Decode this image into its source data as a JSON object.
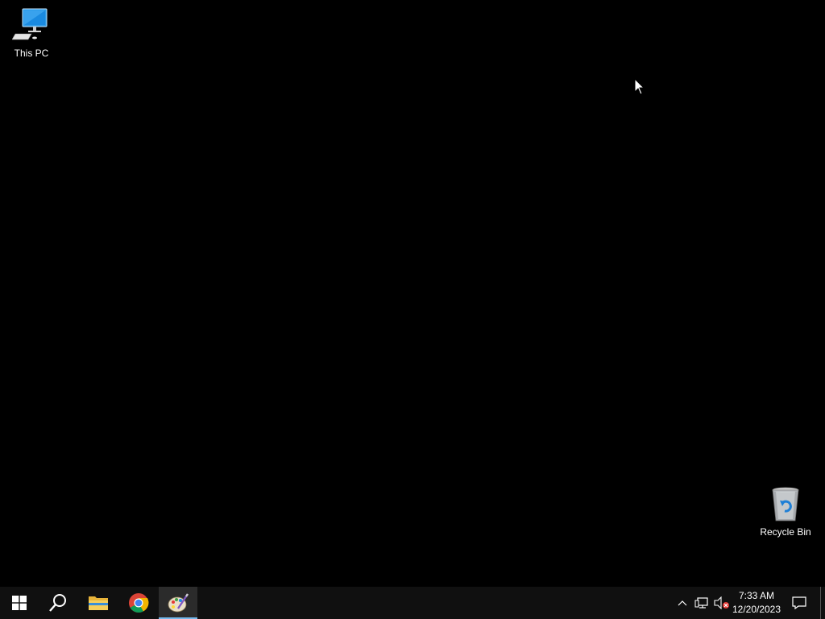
{
  "desktop": {
    "icons": [
      {
        "label": "This PC",
        "icon": "this-pc-icon"
      },
      {
        "label": "Recycle Bin",
        "icon": "recycle-bin-icon"
      }
    ]
  },
  "taskbar": {
    "items": [
      {
        "name": "start",
        "icon": "windows-logo-icon"
      },
      {
        "name": "search",
        "icon": "search-icon"
      },
      {
        "name": "file-explorer",
        "icon": "folder-icon"
      },
      {
        "name": "chrome",
        "icon": "chrome-icon"
      },
      {
        "name": "paint",
        "icon": "paint-icon",
        "active": true
      }
    ],
    "tray": {
      "icons": [
        "chevron-up-icon",
        "network-icon",
        "volume-muted-icon"
      ],
      "time": "7:33 AM",
      "date": "12/20/2023"
    }
  },
  "colors": {
    "desktop_bg": "#000000",
    "taskbar_bg": "#101010",
    "active_underline": "#76b9ed",
    "windows_blue": "#1e90ff"
  }
}
